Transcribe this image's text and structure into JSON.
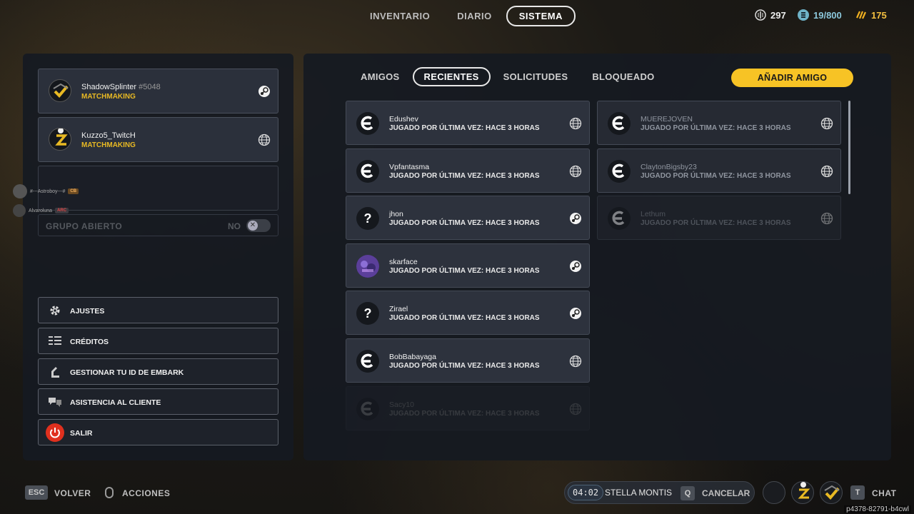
{
  "nav": {
    "tabs": [
      "INVENTARIO",
      "DIARIO",
      "SISTEMA"
    ],
    "active_tab": "SISTEMA",
    "currencies": [
      {
        "value": "297",
        "icon": "coin-icon"
      },
      {
        "value": "19/800",
        "icon": "credit-icon"
      },
      {
        "value": "175",
        "icon": "raider-token-icon"
      }
    ]
  },
  "party": {
    "members": [
      {
        "name": "ShadowSplinter",
        "tag": "#5048",
        "status": "MATCHMAKING",
        "platform": "steam-icon"
      },
      {
        "name": "Kuzzo5_TwitcH",
        "tag": "",
        "status": "MATCHMAKING",
        "platform": "globe-icon"
      }
    ],
    "group_label": "GRUPO ABIERTO",
    "group_value": "NO"
  },
  "floating_players": [
    {
      "name": "#---Astroboy---#",
      "badge": "CB"
    },
    {
      "name": "Alvaroluna",
      "badge": "ARC"
    }
  ],
  "menu": [
    {
      "label": "AJUSTES",
      "icon": "gear-icon"
    },
    {
      "label": "CRÉDITOS",
      "icon": "credits-icon"
    },
    {
      "label": "GESTIONAR TU ID DE EMBARK",
      "icon": "embark-id-icon"
    },
    {
      "label": "ASISTENCIA AL CLIENTE",
      "icon": "support-icon"
    },
    {
      "label": "SALIR",
      "icon": "power-icon"
    }
  ],
  "friends": {
    "tabs": [
      "AMIGOS",
      "RECIENTES",
      "SOLICITUDES",
      "BLOQUEADO"
    ],
    "active_tab": "RECIENTES",
    "add_label": "AÑADIR AMIGO",
    "left_column": [
      {
        "name": "Edushev",
        "status": "JUGADO POR ÚLTIMA VEZ: HACE 3 HORAS",
        "avatar": "E",
        "platform": "globe-icon"
      },
      {
        "name": "Vpfantasma",
        "status": "JUGADO POR ÚLTIMA VEZ: HACE 3 HORAS",
        "avatar": "E",
        "platform": "globe-icon"
      },
      {
        "name": "jhon",
        "status": "JUGADO POR ÚLTIMA VEZ: HACE 3 HORAS",
        "avatar": "?",
        "platform": "steam-icon"
      },
      {
        "name": "skarface",
        "status": "JUGADO POR ÚLTIMA VEZ: HACE 3 HORAS",
        "avatar": "img",
        "platform": "steam-icon"
      },
      {
        "name": "Zirael",
        "status": "JUGADO POR ÚLTIMA VEZ: HACE 3 HORAS",
        "avatar": "?",
        "platform": "steam-icon"
      },
      {
        "name": "BobBabayaga",
        "status": "JUGADO POR ÚLTIMA VEZ: HACE 3 HORAS",
        "avatar": "E",
        "platform": "globe-icon"
      },
      {
        "name": "Sacy10",
        "status": "JUGADO POR ÚLTIMA VEZ: HACE 3 HORAS",
        "avatar": "E",
        "platform": "globe-icon"
      }
    ],
    "right_column": [
      {
        "name": "MUEREJOVEN",
        "status": "JUGADO POR ÚLTIMA VEZ: HACE 3 HORAS",
        "avatar": "E",
        "platform": "globe-icon"
      },
      {
        "name": "ClaytonBigsby23",
        "status": "JUGADO POR ÚLTIMA VEZ: HACE 3 HORAS",
        "avatar": "E",
        "platform": "globe-icon"
      },
      {
        "name": "Lethum",
        "status": "JUGADO POR ÚLTIMA VEZ: HACE 3 HORAS",
        "avatar": "E",
        "platform": "globe-icon"
      }
    ]
  },
  "bottom": {
    "esc_key": "ESC",
    "back_label": "VOLVER",
    "actions_label": "ACCIONES",
    "timer": "04:02",
    "zone": "STELLA MONTIS",
    "cancel_key": "Q",
    "cancel_label": "CANCELAR",
    "chat_key": "T",
    "chat_label": "CHAT",
    "build": "p4378-82791-b4cwl"
  },
  "colors": {
    "accent": "#f7c325",
    "matchmaking": "#e8b923",
    "exit": "#e0301e"
  }
}
